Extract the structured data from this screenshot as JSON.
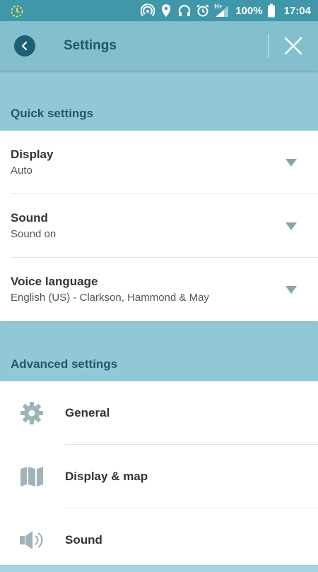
{
  "status_bar": {
    "battery": "100%",
    "time": "17:04",
    "network": "H+",
    "icons": [
      "sync-icon",
      "hotspot-icon",
      "location-icon",
      "headphones-icon",
      "alarm-icon",
      "signal-icon",
      "battery-icon"
    ]
  },
  "top_bar": {
    "title": "Settings",
    "back_icon": "chevron-left-icon",
    "close_icon": "close-icon"
  },
  "quick_settings": {
    "header": "Quick settings",
    "items": [
      {
        "title": "Display",
        "value": "Auto"
      },
      {
        "title": "Sound",
        "value": "Sound on"
      },
      {
        "title": "Voice language",
        "value": "English (US) - Clarkson, Hammond & May"
      }
    ]
  },
  "advanced_settings": {
    "header": "Advanced settings",
    "items": [
      {
        "label": "General",
        "icon": "gear-icon"
      },
      {
        "label": "Display & map",
        "icon": "map-icon"
      },
      {
        "label": "Sound",
        "icon": "speaker-icon"
      }
    ]
  },
  "colors": {
    "status_bar": "#3f97a9",
    "top_bar": "#83bfcd",
    "section_header": "#92c8d6",
    "accent_dark": "#1b5a6d",
    "icon_grey": "#9fb3b9"
  }
}
